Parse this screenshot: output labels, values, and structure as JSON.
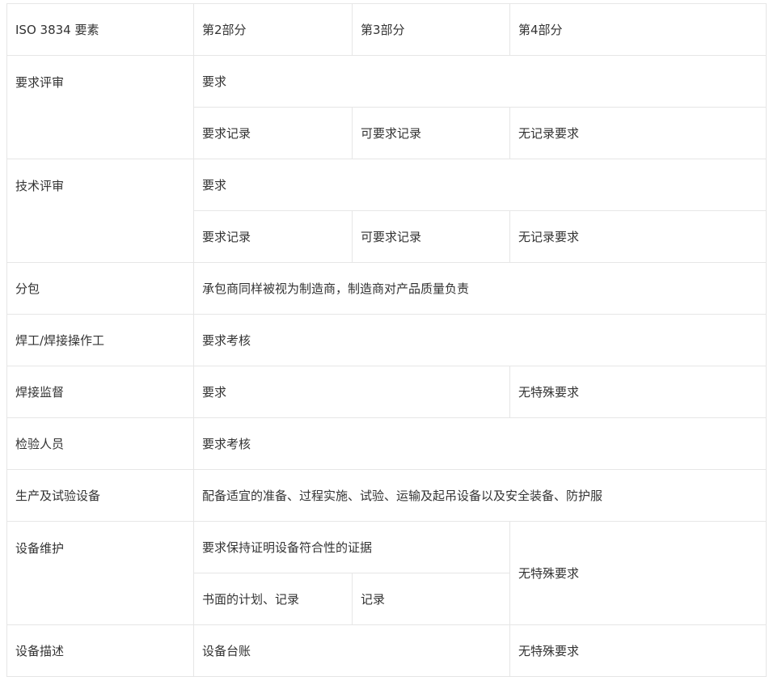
{
  "header": {
    "col1": "ISO 3834 要素",
    "col2": "第2部分",
    "col3": "第3部分",
    "col4": "第4部分"
  },
  "rows": {
    "contract_review": {
      "label": "要求评审",
      "req": "要求",
      "p2": "要求记录",
      "p3": "可要求记录",
      "p4": "无记录要求"
    },
    "design_review": {
      "label": "技术评审",
      "req": "要求",
      "p2": "要求记录",
      "p3": "可要求记录",
      "p4": "无记录要求"
    },
    "subcontracting": {
      "label": "分包",
      "value": "承包商同样被视为制造商，制造商对产品质量负责"
    },
    "welders": {
      "label": "焊工/焊接操作工",
      "value": "要求考核"
    },
    "welding_coordination": {
      "label": "焊接监督",
      "p23": "要求",
      "p4": "无特殊要求"
    },
    "inspection_personnel": {
      "label": "检验人员",
      "value": "要求考核"
    },
    "equipment": {
      "label": "生产及试验设备",
      "value": "配备适宜的准备、过程实施、试验、运输及起吊设备以及安全装备、防护服"
    },
    "maintenance": {
      "label": "设备维护",
      "req": "要求保持证明设备符合性的证据",
      "p2": "书面的计划、记录",
      "p3": "记录",
      "p4": "无特殊要求"
    },
    "description": {
      "label": "设备描述",
      "p23": "设备台账",
      "p4": "无特殊要求"
    }
  }
}
